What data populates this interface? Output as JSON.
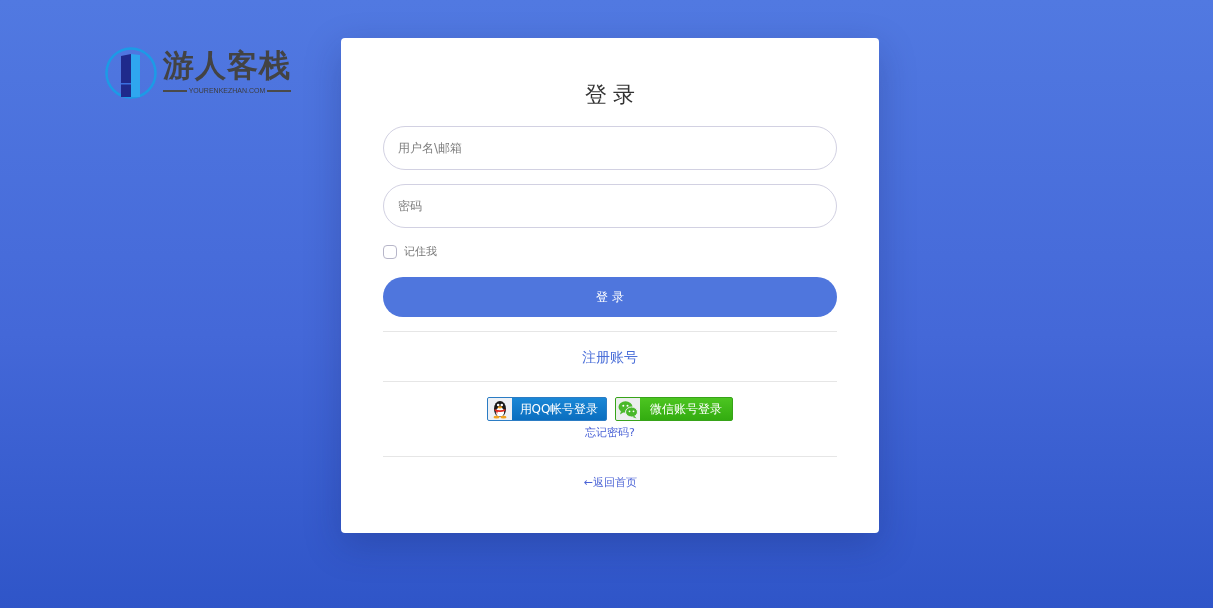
{
  "logo": {
    "name": "游人客栈",
    "tagline": "YOURENKEZHAN.COM"
  },
  "login_form": {
    "title": "登录",
    "username_field": {
      "placeholder": "用户名\\邮箱"
    },
    "password_field": {
      "placeholder": "密码"
    },
    "remember": {
      "label": "记住我",
      "checked": false
    },
    "submit": "登录",
    "register_link": "注册账号",
    "social_buttons": [
      {
        "kind": "qq",
        "label": "用QQ帐号登录"
      },
      {
        "kind": "wechat",
        "label": "微信账号登录"
      }
    ],
    "forgot_link": "忘记密码?",
    "back_link": "←返回首页"
  }
}
